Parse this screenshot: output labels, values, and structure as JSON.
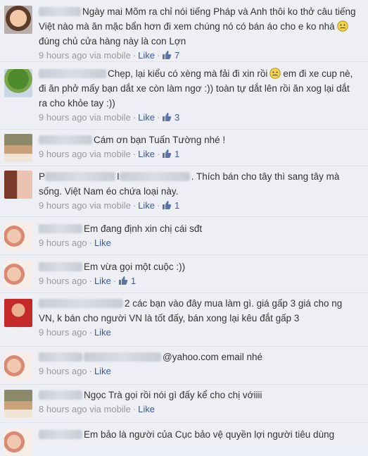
{
  "comments": [
    {
      "text": "Ngày mai Mõm ra chỉ nói tiếng Pháp và Anh thôi ko thở câu tiếng Việt nào mà ăn mặc bẩn hơn đi xem chúng nó có bán áo cho e ko nhá",
      "text_after_emoji": "đúng chủ cửa hàng này là con Lợn",
      "time": "9 hours ago",
      "via": "via mobile",
      "like_label": "Like",
      "likes": "7"
    },
    {
      "text": "Chẹp, lại kiểu có xèng mà fải đi xin rồi",
      "text_after_emoji": "em đi xe cup nè, đi ăn phở mấy bạn dắt xe còn làm ngơ :)) toàn tự dắt lên rồi ăn xog lại dắt ra cho khỏe tay :))",
      "time": "9 hours ago",
      "via": "via mobile",
      "like_label": "Like",
      "likes": "3"
    },
    {
      "text": "Cám ơn bạn Tuấn Tường nhé !",
      "time": "9 hours ago",
      "via": "via mobile",
      "like_label": "Like",
      "likes": "1"
    },
    {
      "text_prefix_a": "P",
      "text_prefix_b": "I",
      "text": ". Thích bán cho tây thì sang tây mà sống. Việt Nam éo chứa loại này.",
      "time": "9 hours ago",
      "via": "via mobile",
      "like_label": "Like",
      "likes": "1"
    },
    {
      "text": "Em đang định xin chị cái sđt",
      "time": "9 hours ago",
      "like_label": "Like"
    },
    {
      "text": "Em vừa gọi một cuộc :))",
      "time": "9 hours ago",
      "like_label": "Like",
      "likes": "1"
    },
    {
      "text_prefix_a": "2",
      "text": "các bạn vào đây mua làm gì. giá gấp 3 giá cho ng VN, k bán cho người VN là tốt đấy, bán xong lại kêu đắt gấp 3",
      "time": "9 hours ago",
      "like_label": "Like"
    },
    {
      "text": "@yahoo.com email nhé",
      "time": "9 hours ago",
      "like_label": "Like"
    },
    {
      "text": "Ngọc Trà gọi rồi nói gì đấy kể cho chị vớiiii",
      "time": "8 hours ago",
      "via": "via mobile",
      "like_label": "Like"
    },
    {
      "text": "Em bảo là người của Cục bảo vệ quyền lợi người tiêu dùng"
    }
  ],
  "separator": "·",
  "colors": {
    "link": "#3b5998",
    "meta": "#999999",
    "background": "#edeff4"
  },
  "icons": [
    "thumbs-up-icon",
    "smiley-emoji-icon"
  ]
}
